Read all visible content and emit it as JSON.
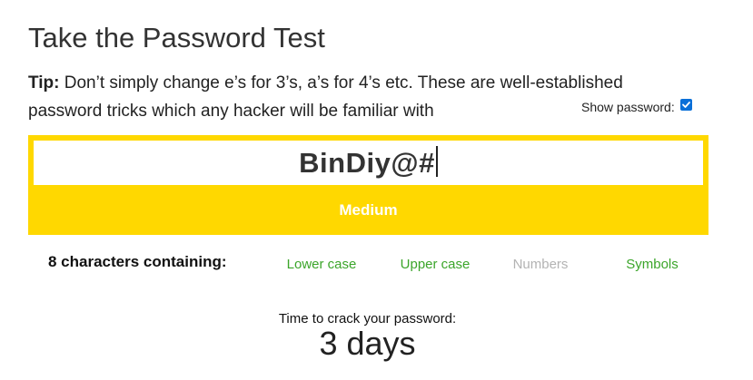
{
  "page": {
    "title": "Take the Password Test"
  },
  "tip": {
    "label": "Tip:",
    "text": "Don’t simply change e’s for 3’s, a’s for 4’s etc. These are well-established password tricks which any hacker will be familiar with"
  },
  "show_password": {
    "label": "Show password:",
    "checked": true
  },
  "password": {
    "value": "BinDiy@#",
    "strength": "Medium",
    "strength_color": "#ffd800"
  },
  "requirements": {
    "label": "8 characters containing:",
    "items": [
      {
        "label": "Lower case",
        "met": true
      },
      {
        "label": "Upper case",
        "met": true
      },
      {
        "label": "Numbers",
        "met": false
      },
      {
        "label": "Symbols",
        "met": true
      }
    ],
    "met_color": "#3ba52a",
    "unmet_color": "#b3b3b3"
  },
  "crack_time": {
    "label": "Time to crack your password:",
    "value": "3 days"
  }
}
